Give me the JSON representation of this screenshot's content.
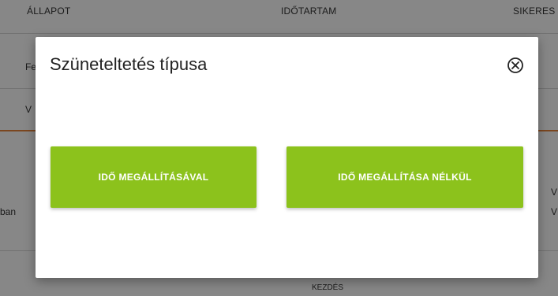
{
  "background": {
    "columns": [
      "ÁLLAPOT",
      "IDŐTARTAM",
      "SIKERES"
    ],
    "row_fragments": [
      "Fe",
      "V",
      "ban",
      "V",
      "V"
    ],
    "footer_fragment": "KEZDÉS"
  },
  "modal": {
    "title": "Szüneteltetés típusa",
    "close_icon": "close-circle-icon",
    "buttons": {
      "with_stop": "IDŐ MEGÁLLÍTÁSÁVAL",
      "without_stop": "IDŐ MEGÁLLÍTÁSA NÉLKÜL"
    }
  },
  "colors": {
    "button": "#8cc21c",
    "accent_line": "#e8843c",
    "overlay": "rgba(0,0,0,0.47)"
  }
}
